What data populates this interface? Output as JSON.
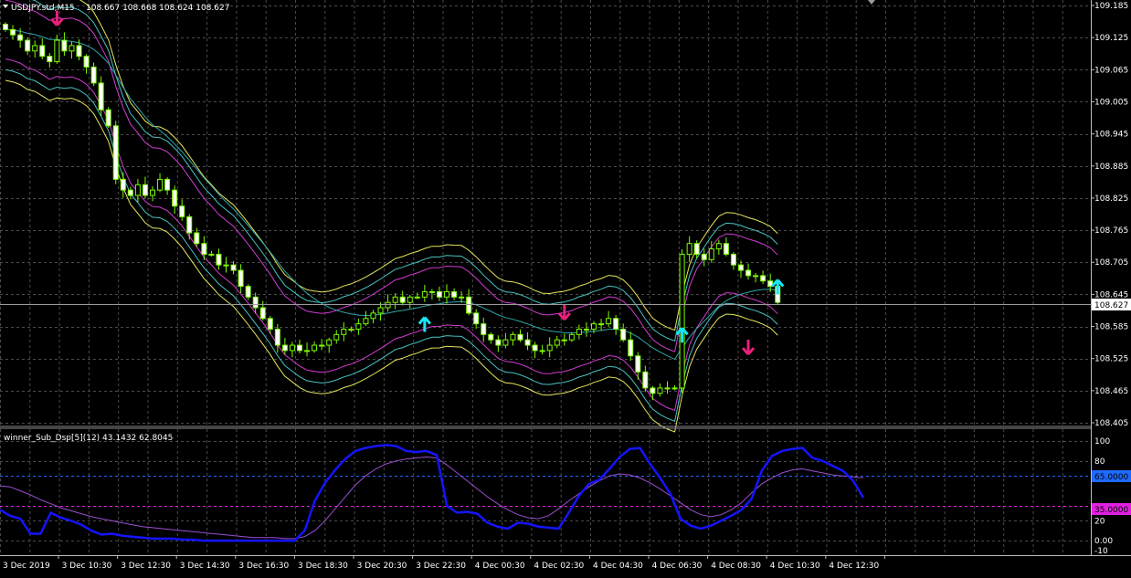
{
  "main_chart": {
    "title": "USDJPY.std,M15",
    "ohlc_readout": "108.667 108.668 108.624 108.627",
    "current_price_label": "108.627",
    "price_axis": [
      "109.185",
      "109.125",
      "109.065",
      "109.005",
      "108.945",
      "108.885",
      "108.825",
      "108.765",
      "108.705",
      "108.645",
      "108.585",
      "108.525",
      "108.465",
      "108.405"
    ],
    "price_range": [
      108.405,
      109.185
    ]
  },
  "sub_window": {
    "title": "winner_Sub_Dsp[5](12) 43.1432 62.8045",
    "axis_labels": [
      "100",
      "80",
      "65.0000",
      "35.0000",
      "20",
      "0.00",
      "-10"
    ],
    "level_high_label": "65.0000",
    "level_low_label": "35.0000",
    "range": [
      -10,
      100
    ]
  },
  "time_axis": [
    "3 Dec 2019",
    "3 Dec 10:30",
    "3 Dec 12:30",
    "3 Dec 14:30",
    "3 Dec 16:30",
    "3 Dec 18:30",
    "3 Dec 20:30",
    "3 Dec 22:30",
    "4 Dec 00:30",
    "4 Dec 02:30",
    "4 Dec 04:30",
    "4 Dec 06:30",
    "4 Dec 08:30",
    "4 Dec 10:30",
    "4 Dec 12:30"
  ],
  "colors": {
    "background": "#000000",
    "grid": "#4a4a4a",
    "candle": "#7CFC00",
    "candle_bull_body": "#000000",
    "candle_bear_body": "#ffffff",
    "band_outer": "#e6e65a",
    "band_mid": "#48c2c2",
    "band_inner": "#d23cd2",
    "ma": "#2fa6a6",
    "arrow_down": "#e8207a",
    "arrow_up": "#17e5f5",
    "osc_main": "#1414ff",
    "osc_signal": "#9b4fd0",
    "level_high": "#1e6aff",
    "level_low": "#e020e0"
  },
  "chart_data": {
    "type": "candlestick",
    "symbol": "USDJPY.std",
    "timeframe": "M15",
    "ylim": [
      108.405,
      109.185
    ],
    "close_path": [
      109.14,
      109.13,
      109.12,
      109.1,
      109.11,
      109.09,
      109.08,
      109.12,
      109.1,
      109.11,
      109.09,
      109.07,
      109.04,
      108.99,
      108.96,
      108.86,
      108.84,
      108.83,
      108.85,
      108.83,
      108.84,
      108.86,
      108.84,
      108.81,
      108.79,
      108.76,
      108.74,
      108.72,
      108.72,
      108.7,
      108.7,
      108.69,
      108.66,
      108.64,
      108.62,
      108.6,
      108.58,
      108.55,
      108.54,
      108.55,
      108.54,
      108.54,
      108.55,
      108.55,
      108.56,
      108.57,
      108.58,
      108.58,
      108.59,
      108.6,
      108.61,
      108.62,
      108.63,
      108.64,
      108.63,
      108.64,
      108.64,
      108.65,
      108.65,
      108.64,
      108.65,
      108.64,
      108.64,
      108.61,
      108.59,
      108.57,
      108.56,
      108.55,
      108.56,
      108.57,
      108.56,
      108.55,
      108.54,
      108.54,
      108.55,
      108.56,
      108.56,
      108.57,
      108.58,
      108.58,
      108.59,
      108.59,
      108.6,
      108.58,
      108.56,
      108.53,
      108.5,
      108.47,
      108.46,
      108.47,
      108.47,
      108.47,
      108.72,
      108.74,
      108.72,
      108.71,
      108.73,
      108.74,
      108.72,
      108.7,
      108.69,
      108.68,
      108.68,
      108.67,
      108.66,
      108.63
    ],
    "signal_arrows": [
      {
        "type": "sell",
        "time": "3 Dec 10:00",
        "price": 109.165
      },
      {
        "type": "buy",
        "time": "3 Dec 23:15",
        "price": 108.585
      },
      {
        "type": "sell",
        "time": "4 Dec 03:00",
        "price": 108.615
      },
      {
        "type": "buy",
        "time": "4 Dec 07:00",
        "price": 108.565
      },
      {
        "type": "sell",
        "time": "4 Dec 09:15",
        "price": 108.55
      },
      {
        "type": "buy",
        "time": "4 Dec 11:00",
        "price": 108.655
      }
    ],
    "oscillator": {
      "name": "winner_Sub_Dsp[5](12)",
      "ylim": [
        -10,
        100
      ],
      "levels": [
        65,
        35
      ],
      "main_value": 43.1432,
      "signal_value": 62.8045,
      "main": [
        31,
        25,
        22,
        7,
        7,
        28,
        23,
        20,
        16,
        10,
        6,
        7,
        5,
        4,
        3,
        2,
        2,
        2,
        1,
        1,
        0,
        0,
        0,
        0,
        0,
        0,
        0,
        0,
        0,
        0,
        10,
        40,
        58,
        71,
        82,
        90,
        93,
        95,
        96,
        95,
        90,
        89,
        90,
        86,
        35,
        28,
        29,
        27,
        18,
        14,
        12,
        18,
        17,
        14,
        13,
        12,
        28,
        45,
        57,
        61,
        72,
        84,
        92,
        93,
        77,
        63,
        47,
        22,
        15,
        12,
        15,
        20,
        25,
        31,
        42,
        70,
        85,
        90,
        92,
        93,
        83,
        80,
        75,
        70,
        60,
        43
      ],
      "signal": [
        55,
        54,
        50,
        46,
        41,
        37,
        33,
        30,
        27,
        24,
        22,
        20,
        18,
        16,
        14,
        13,
        12,
        11,
        10,
        9,
        8,
        7,
        6,
        5,
        4,
        3,
        3,
        3,
        2,
        2,
        4,
        10,
        20,
        32,
        44,
        56,
        65,
        72,
        77,
        80,
        82,
        83,
        84,
        83,
        76,
        68,
        60,
        52,
        44,
        37,
        31,
        26,
        23,
        22,
        25,
        32,
        40,
        47,
        54,
        60,
        65,
        67,
        66,
        63,
        58,
        52,
        45,
        38,
        31,
        26,
        24,
        26,
        31,
        38,
        48,
        57,
        63,
        68,
        71,
        72,
        70,
        68,
        66,
        65,
        64,
        63
      ]
    }
  }
}
